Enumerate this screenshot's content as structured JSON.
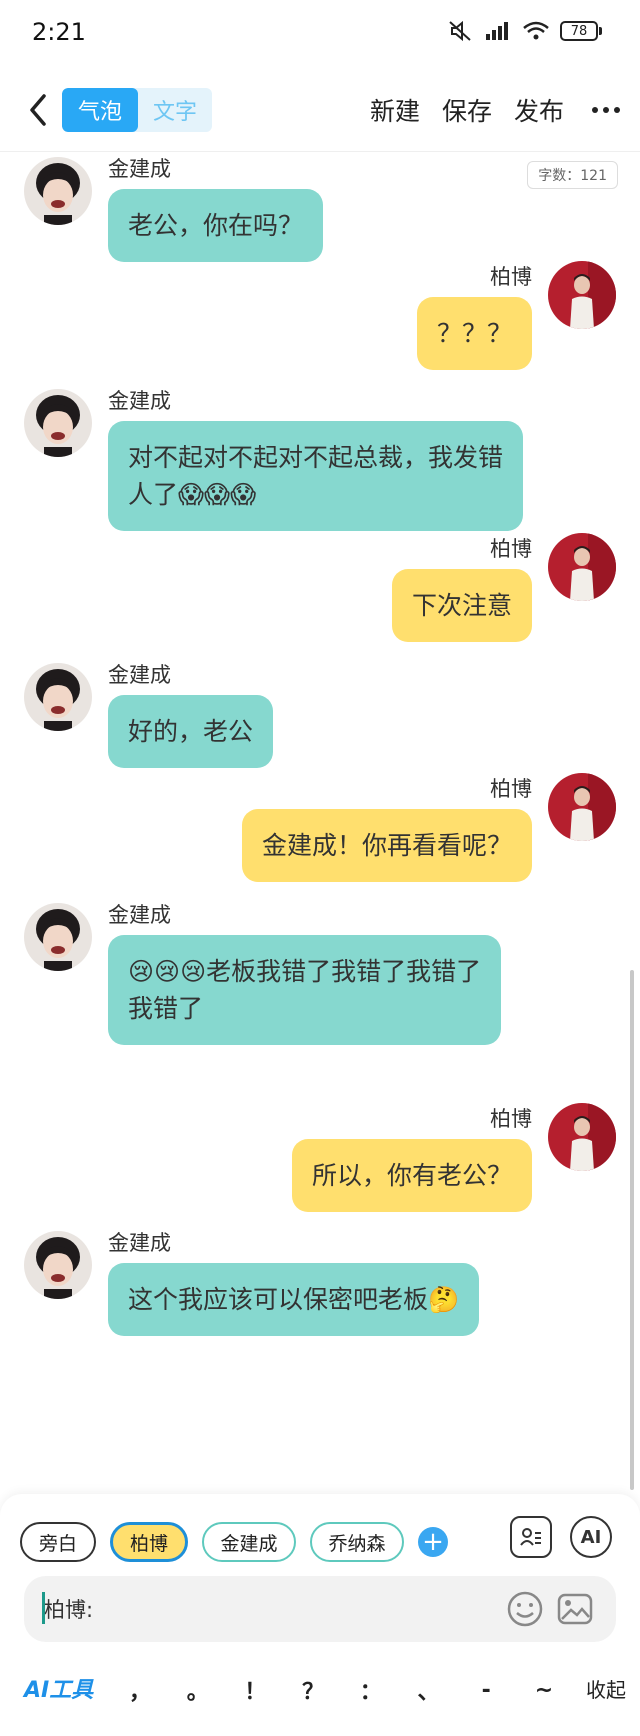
{
  "status_bar": {
    "time": "2:21",
    "battery": "78"
  },
  "nav": {
    "tab_bubble": "气泡",
    "tab_text": "文字",
    "new": "新建",
    "save": "保存",
    "publish": "发布"
  },
  "word_count": "字数：121",
  "messages": [
    {
      "side": "left",
      "sender": "金建成",
      "text": "老公，你在吗？"
    },
    {
      "side": "right",
      "sender": "柏博",
      "text": "？？？"
    },
    {
      "side": "left",
      "sender": "金建成",
      "text": "对不起对不起对不起总裁，我发错\n人了😱😱😱"
    },
    {
      "side": "right",
      "sender": "柏博",
      "text": "下次注意"
    },
    {
      "side": "left",
      "sender": "金建成",
      "text": "好的，老公"
    },
    {
      "side": "right",
      "sender": "柏博",
      "text": "金建成！你再看看呢？"
    },
    {
      "side": "left",
      "sender": "金建成",
      "text": "😢😢😢老板我错了我错了我错了\n我错了"
    },
    {
      "side": "right",
      "sender": "柏博",
      "text": "所以，你有老公？"
    },
    {
      "side": "left",
      "sender": "金建成",
      "text": "这个我应该可以保密吧老板🤔"
    }
  ],
  "characters": {
    "narrator": "旁白",
    "c1": "柏博",
    "c2": "金建成",
    "c3": "乔纳森",
    "add": "+"
  },
  "ai_label": "AI",
  "input": {
    "value": "柏博:"
  },
  "toolbar": {
    "ai_tools": "AI工具",
    "punctuation": [
      "，",
      "。",
      "！",
      "？",
      "：",
      "、",
      "-",
      "~"
    ],
    "collapse": "收起"
  },
  "colors": {
    "accent": "#29a8f5",
    "left_bubble": "#86d8cf",
    "right_bubble": "#ffdf6e"
  },
  "icons": [
    "back-arrow-icon",
    "more-icon",
    "contact-card-icon",
    "emoji-icon",
    "image-icon"
  ]
}
